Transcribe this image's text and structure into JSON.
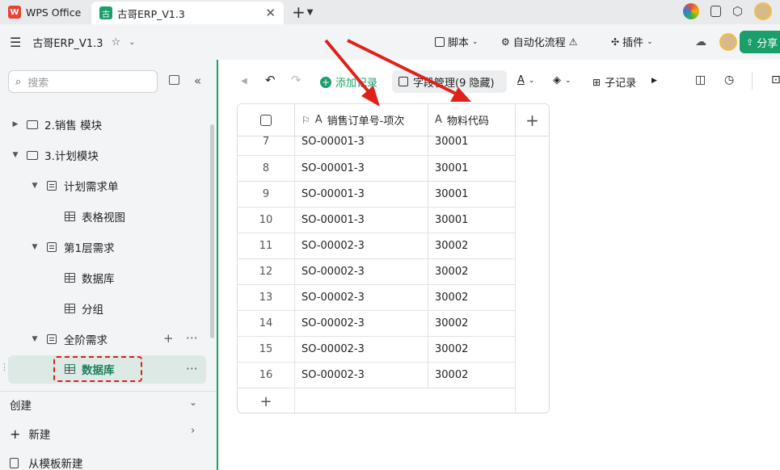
{
  "titlebar": {
    "tabs": [
      {
        "label": "WPS Office",
        "logo": "W"
      },
      {
        "label": "古哥ERP_V1.3",
        "logo": "古"
      }
    ]
  },
  "header": {
    "doc_title": "古哥ERP_V1.3",
    "script_label": "脚本",
    "automation_label": "自动化流程",
    "plugin_label": "插件",
    "share_label": "分享"
  },
  "sidebar": {
    "search_placeholder": "搜索",
    "tree": [
      {
        "label": "2.销售 模块"
      },
      {
        "label": "3.计划模块"
      },
      {
        "label": "计划需求单"
      },
      {
        "label": "表格视图"
      },
      {
        "label": "第1层需求"
      },
      {
        "label": "数据库"
      },
      {
        "label": "分组"
      },
      {
        "label": "全阶需求"
      },
      {
        "label": "数据库"
      }
    ],
    "create_label": "创建",
    "new_label": "新建",
    "from_template_label": "从模板新建"
  },
  "toolbar": {
    "add_record_label": "添加记录",
    "field_manage_label": "字段管理(9 隐藏)",
    "font_color_label": "A",
    "sub_record_label": "子记录"
  },
  "grid": {
    "columns": [
      "销售订单号-项次",
      "物料代码"
    ],
    "rows": [
      {
        "num": "7",
        "order": "SO-00001-3",
        "code": "30001"
      },
      {
        "num": "8",
        "order": "SO-00001-3",
        "code": "30001"
      },
      {
        "num": "9",
        "order": "SO-00001-3",
        "code": "30001"
      },
      {
        "num": "10",
        "order": "SO-00001-3",
        "code": "30001"
      },
      {
        "num": "11",
        "order": "SO-00002-3",
        "code": "30002"
      },
      {
        "num": "12",
        "order": "SO-00002-3",
        "code": "30002"
      },
      {
        "num": "13",
        "order": "SO-00002-3",
        "code": "30002"
      },
      {
        "num": "14",
        "order": "SO-00002-3",
        "code": "30002"
      },
      {
        "num": "15",
        "order": "SO-00002-3",
        "code": "30002"
      },
      {
        "num": "16",
        "order": "SO-00002-3",
        "code": "30002"
      }
    ]
  },
  "colors": {
    "accent": "#1a9e6a",
    "annotation": "#e0201a",
    "selection": "#dce9e5"
  }
}
